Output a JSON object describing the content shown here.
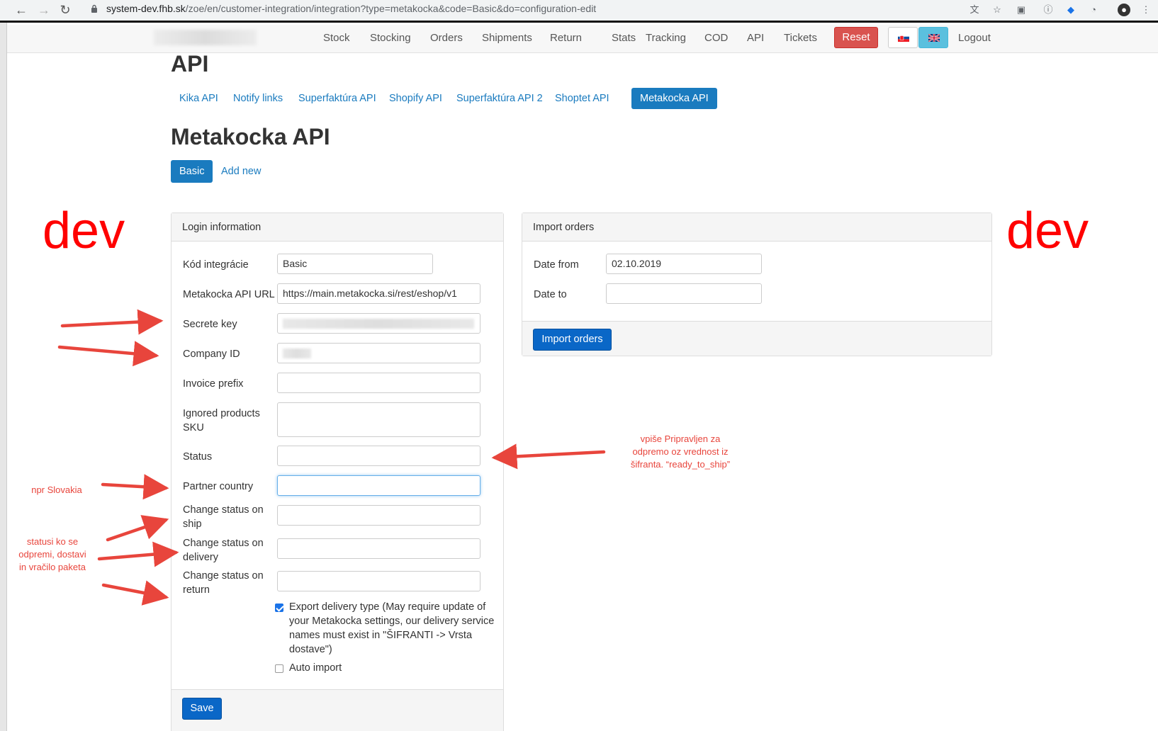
{
  "browser": {
    "url_host": "system-dev.fhb.sk",
    "url_path": "/zoe/en/customer-integration/integration?type=metakocka&code=Basic&do=configuration-edit"
  },
  "topnav": {
    "items": [
      "Stock",
      "Stocking",
      "Orders",
      "Shipments",
      "Return",
      "Stats",
      "Tracking",
      "COD",
      "API",
      "Tickets"
    ],
    "reset_label": "Reset",
    "logout_label": "Logout"
  },
  "page": {
    "title": "API",
    "api_tabs": [
      "Kika API",
      "Notify links",
      "Superfaktúra API",
      "Shopify API",
      "Superfaktúra API 2",
      "Shoptet API",
      "Metakocka API"
    ],
    "active_tab": "Metakocka API",
    "section_title": "Metakocka API",
    "sub_tabs": [
      "Basic",
      "Add new"
    ]
  },
  "login_panel": {
    "title": "Login information",
    "fields": {
      "kod_label": "Kód integrácie",
      "kod_value": "Basic",
      "url_label": "Metakocka API URL",
      "url_value": "https://main.metakocka.si/rest/eshop/v1",
      "secret_label": "Secrete key",
      "company_label": "Company ID",
      "invoice_label": "Invoice prefix",
      "ignored_label_1": "Ignored products",
      "ignored_label_2": "SKU",
      "status_label": "Status",
      "partner_label": "Partner country",
      "ship_label_1": "Change status on",
      "ship_label_2": "ship",
      "delivery_label_1": "Change status on",
      "delivery_label_2": "delivery",
      "return_label_1": "Change status on",
      "return_label_2": "return"
    },
    "export_lines": [
      "Export delivery type (May require update of",
      "your Metakocka settings, our delivery service",
      "names must exist in \"ŠIFRANTI -> Vrsta",
      "dostave\")"
    ],
    "export_checked": true,
    "auto_import_label": "Auto import",
    "auto_import_checked": false,
    "save_label": "Save"
  },
  "import_panel": {
    "title": "Import orders",
    "date_from_label": "Date from",
    "date_from_value": "02.10.2019",
    "date_to_label": "Date to",
    "date_to_value": "",
    "button_label": "Import orders"
  },
  "annotations": {
    "dev_left": "dev",
    "dev_right": "dev",
    "npr": "npr Slovakia",
    "statusi": [
      "statusi ko se",
      "odpremi, dostavi",
      "in vračilo paketa"
    ],
    "vpise": [
      "vpiše Pripravljen za",
      "odpremo oz vrednost iz",
      "šifranta. “ready_to_ship”"
    ],
    "arrow_color": "#e8453c",
    "dev_color": "#ff0000"
  }
}
